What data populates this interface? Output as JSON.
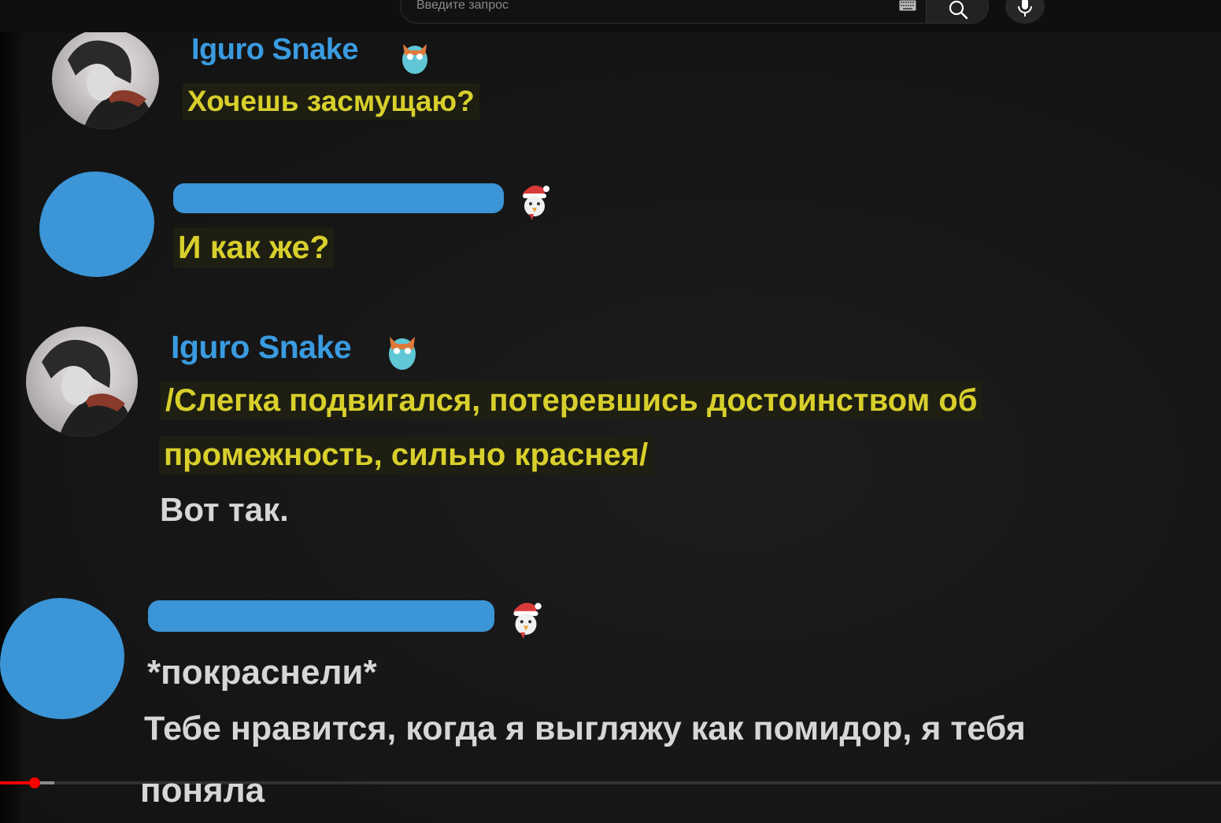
{
  "search": {
    "placeholder": "Введите запрос"
  },
  "chat": {
    "messages": [
      {
        "author": "Iguro Snake",
        "lines": [
          "Хочешь засмущаю?"
        ]
      },
      {
        "author": "",
        "lines": [
          "И как же?"
        ]
      },
      {
        "author": "Iguro Snake",
        "lines": [
          "/Слегка подвигался, потеревшись достоинством об",
          "промежность, сильно краснея/",
          "Вот так."
        ]
      },
      {
        "author": "",
        "lines": [
          "*покраснели*",
          "Тебе нравится, когда я выгляжу как помидор, я тебя",
          "поняла"
        ]
      }
    ]
  },
  "player": {
    "progress_fraction": 0.028,
    "buffered_fraction": 0.044
  },
  "colors": {
    "name": "#3a9be0",
    "highlight_text": "#d8cf2c",
    "redaction": "#3b95d6",
    "progress": "#ff0000"
  },
  "icons": [
    "keyboard-icon",
    "search-icon",
    "mic-icon",
    "owl-emoji-icon",
    "santa-emoji-icon"
  ]
}
